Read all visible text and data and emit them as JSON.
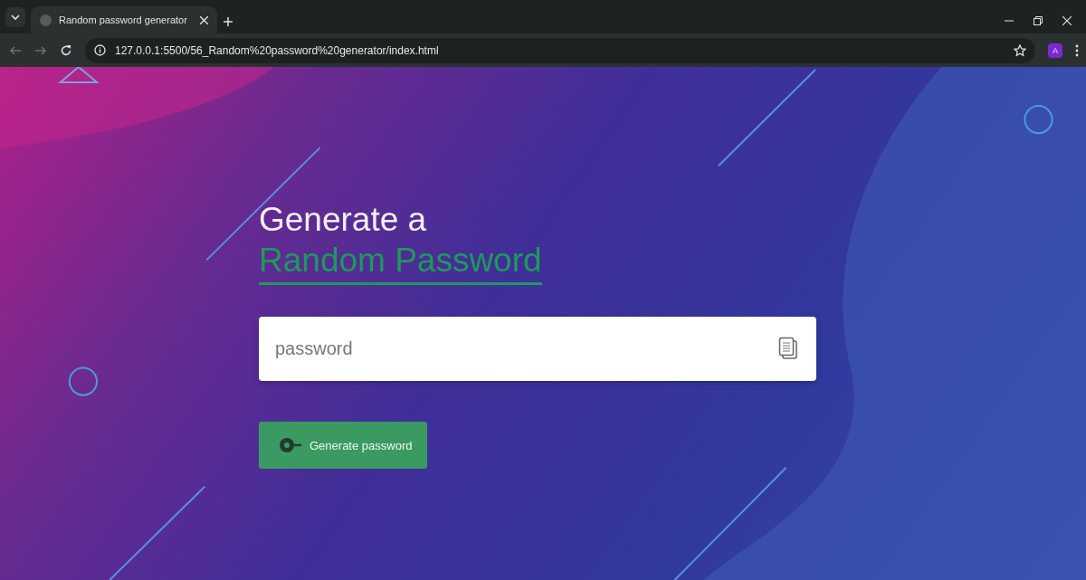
{
  "browser": {
    "tabs": [
      {
        "title": "Random password generator",
        "selected": true
      }
    ],
    "address": "127.0.0.1:5500/56_Random%20password%20generator/index.html",
    "profile_initial": "A"
  },
  "page": {
    "heading": "Generate a",
    "highlight": "Random Password",
    "password_field": {
      "placeholder": "password"
    },
    "generate_button": "Generate password"
  }
}
